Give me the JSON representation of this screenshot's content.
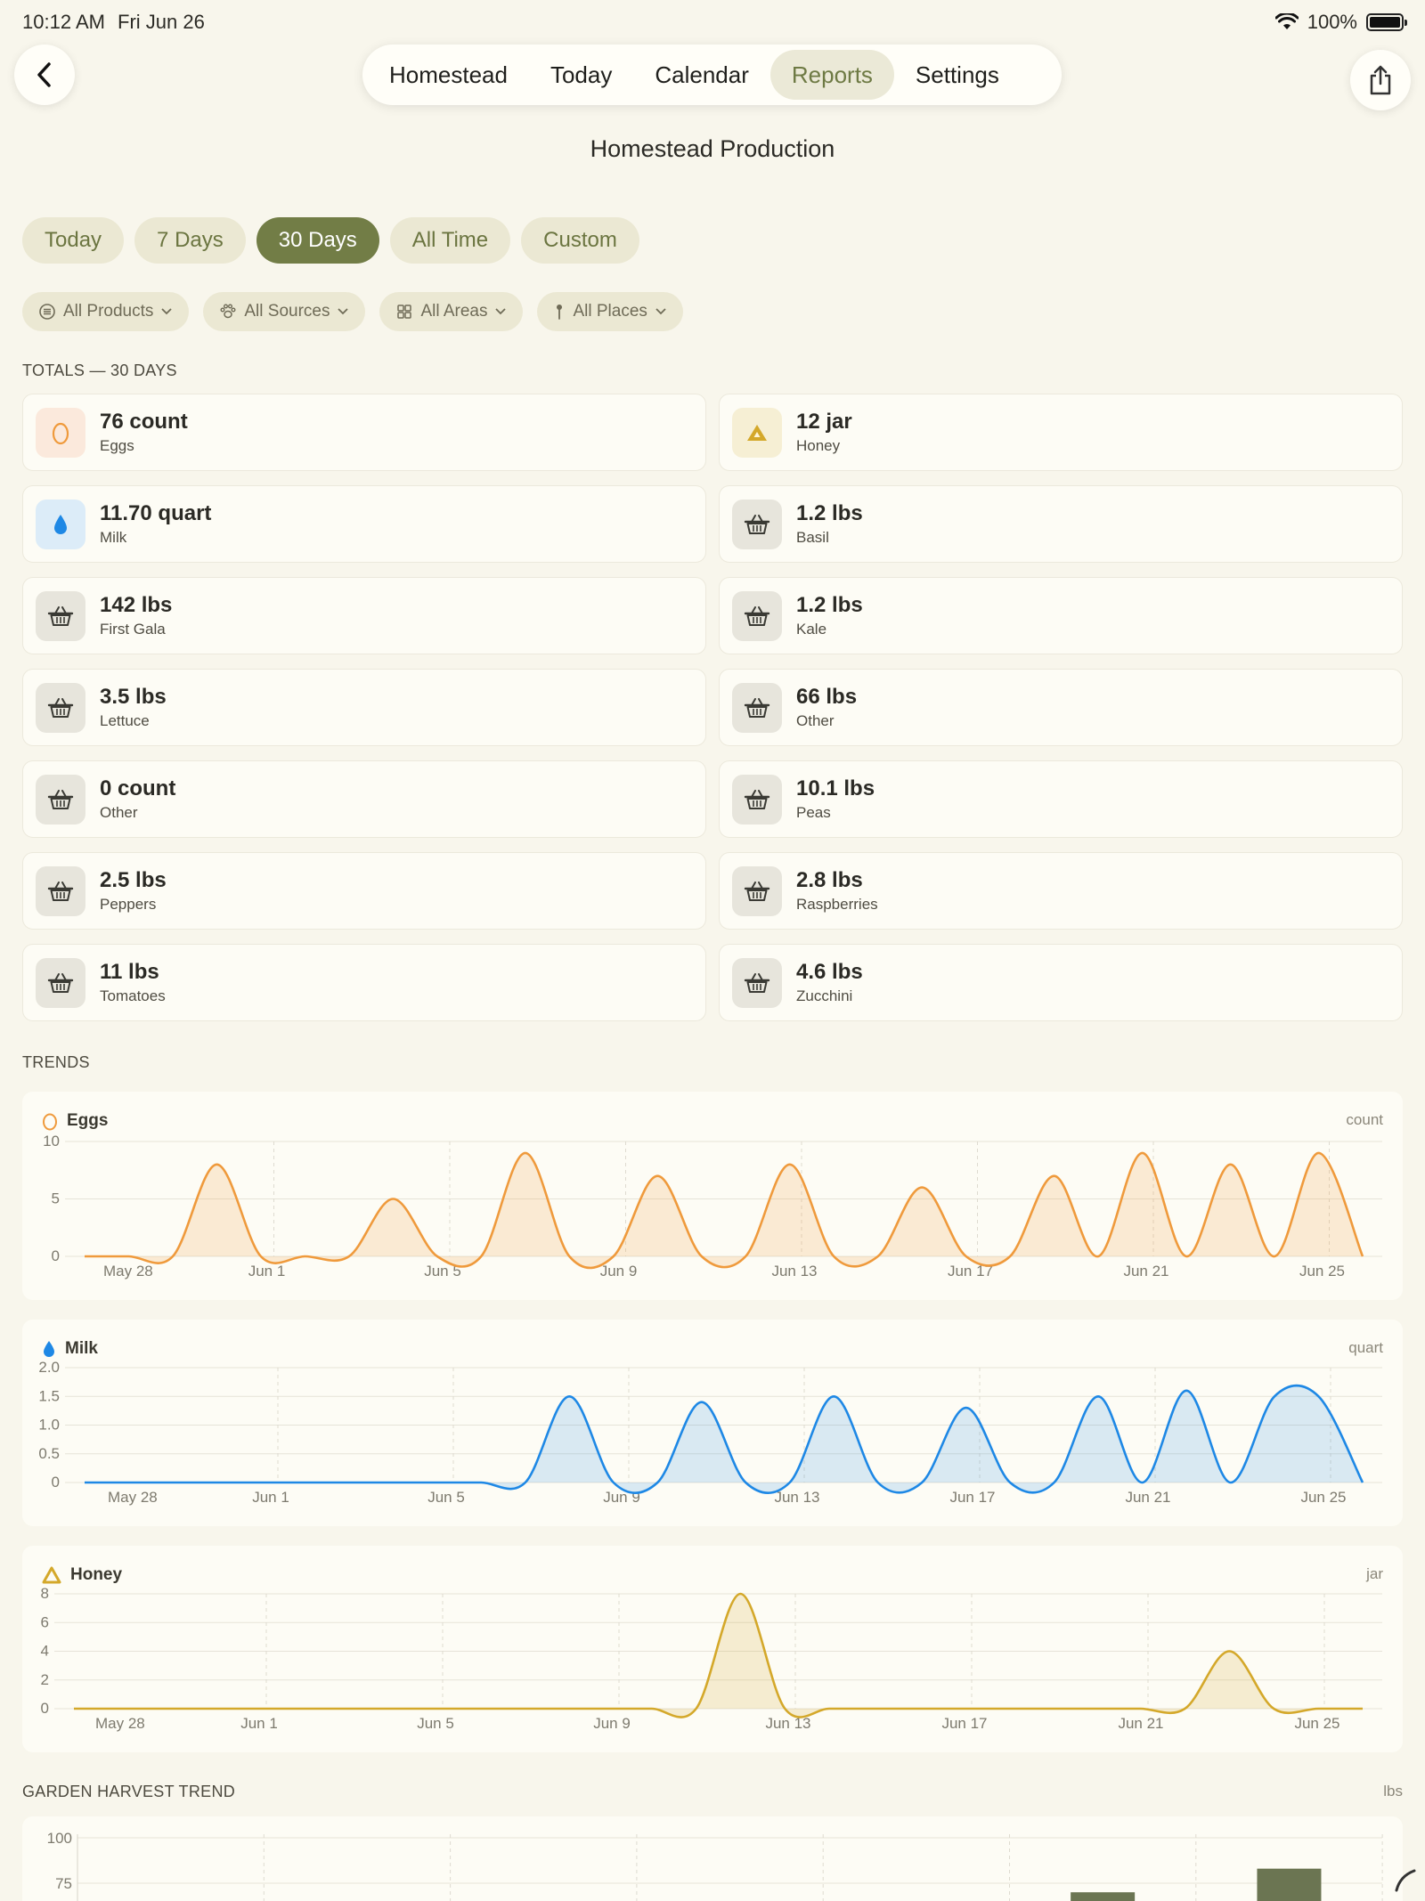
{
  "status": {
    "time": "10:12 AM",
    "date": "Fri Jun 26",
    "battery": "100%"
  },
  "nav": {
    "tabs": [
      "Homestead",
      "Today",
      "Calendar",
      "Reports",
      "Settings"
    ],
    "active": "Reports"
  },
  "page_title": "Homestead Production",
  "ranges": {
    "items": [
      "Today",
      "7 Days",
      "30 Days",
      "All Time",
      "Custom"
    ],
    "active": "30 Days"
  },
  "filters": [
    "All Products",
    "All Sources",
    "All Areas",
    "All Places"
  ],
  "totals_label": "TOTALS — 30 DAYS",
  "totals": [
    {
      "value": "76 count",
      "label": "Eggs",
      "icon": "egg-icon"
    },
    {
      "value": "12 jar",
      "label": "Honey",
      "icon": "honey-icon"
    },
    {
      "value": "11.70 quart",
      "label": "Milk",
      "icon": "milk-drop-icon"
    },
    {
      "value": "1.2 lbs",
      "label": "Basil",
      "icon": "basket-icon"
    },
    {
      "value": "142 lbs",
      "label": "First Gala",
      "icon": "basket-icon"
    },
    {
      "value": "1.2 lbs",
      "label": "Kale",
      "icon": "basket-icon"
    },
    {
      "value": "3.5 lbs",
      "label": "Lettuce",
      "icon": "basket-icon"
    },
    {
      "value": "66 lbs",
      "label": "Other",
      "icon": "basket-icon"
    },
    {
      "value": "0 count",
      "label": "Other",
      "icon": "basket-icon"
    },
    {
      "value": "10.1 lbs",
      "label": "Peas",
      "icon": "basket-icon"
    },
    {
      "value": "2.5 lbs",
      "label": "Peppers",
      "icon": "basket-icon"
    },
    {
      "value": "2.8 lbs",
      "label": "Raspberries",
      "icon": "basket-icon"
    },
    {
      "value": "11 lbs",
      "label": "Tomatoes",
      "icon": "basket-icon"
    },
    {
      "value": "4.6 lbs",
      "label": "Zucchini",
      "icon": "basket-icon"
    }
  ],
  "trends_label": "TRENDS",
  "garden_label": "GARDEN HARVEST TREND",
  "garden_unit": "lbs",
  "colors": {
    "accent": "#727d46",
    "eggs": "#ef9a3c",
    "milk": "#1e88e5",
    "honey": "#d4a82a",
    "bars": "#6b7552"
  },
  "chart_data": [
    {
      "type": "area",
      "title": "Eggs",
      "unit": "count",
      "x_ticks": [
        "May 28",
        "Jun 1",
        "Jun 5",
        "Jun 9",
        "Jun 13",
        "Jun 17",
        "Jun 21",
        "Jun 25"
      ],
      "ylim": [
        0,
        10
      ],
      "y_ticks": [
        0,
        5,
        10
      ],
      "x": [
        "May 28",
        "May 29",
        "May 30",
        "May 31",
        "Jun 1",
        "Jun 2",
        "Jun 3",
        "Jun 4",
        "Jun 5",
        "Jun 6",
        "Jun 7",
        "Jun 8",
        "Jun 9",
        "Jun 10",
        "Jun 11",
        "Jun 12",
        "Jun 13",
        "Jun 14",
        "Jun 15",
        "Jun 16",
        "Jun 17",
        "Jun 18",
        "Jun 19",
        "Jun 20",
        "Jun 21",
        "Jun 22",
        "Jun 23",
        "Jun 24",
        "Jun 25",
        "Jun 26"
      ],
      "values": [
        0,
        0,
        0,
        8,
        0,
        0,
        0,
        5,
        0,
        0,
        9,
        0,
        0,
        7,
        0,
        0,
        8,
        0,
        0,
        6,
        0,
        0,
        7,
        0,
        9,
        0,
        8,
        0,
        9,
        0
      ],
      "grid": true
    },
    {
      "type": "area",
      "title": "Milk",
      "unit": "quart",
      "x_ticks": [
        "May 28",
        "Jun 1",
        "Jun 5",
        "Jun 9",
        "Jun 13",
        "Jun 17",
        "Jun 21",
        "Jun 25"
      ],
      "ylim": [
        0,
        2.0
      ],
      "y_ticks": [
        "0",
        "0.5",
        "1.0",
        "1.5",
        "2.0"
      ],
      "x": [
        "May 28",
        "May 29",
        "May 30",
        "May 31",
        "Jun 1",
        "Jun 2",
        "Jun 3",
        "Jun 4",
        "Jun 5",
        "Jun 6",
        "Jun 7",
        "Jun 8",
        "Jun 9",
        "Jun 10",
        "Jun 11",
        "Jun 12",
        "Jun 13",
        "Jun 14",
        "Jun 15",
        "Jun 16",
        "Jun 17",
        "Jun 18",
        "Jun 19",
        "Jun 20",
        "Jun 21",
        "Jun 22",
        "Jun 23",
        "Jun 24",
        "Jun 25",
        "Jun 26"
      ],
      "values": [
        0,
        0,
        0,
        0,
        0,
        0,
        0,
        0,
        0,
        0,
        0,
        1.5,
        0,
        0,
        1.4,
        0,
        0,
        1.5,
        0,
        0,
        1.3,
        0,
        0,
        1.5,
        0,
        1.6,
        0,
        1.5,
        1.5,
        0
      ],
      "grid": true
    },
    {
      "type": "area",
      "title": "Honey",
      "unit": "jar",
      "x_ticks": [
        "May 28",
        "Jun 1",
        "Jun 5",
        "Jun 9",
        "Jun 13",
        "Jun 17",
        "Jun 21",
        "Jun 25"
      ],
      "ylim": [
        0,
        8
      ],
      "y_ticks": [
        0,
        2,
        4,
        6,
        8
      ],
      "x": [
        "May 28",
        "May 29",
        "May 30",
        "May 31",
        "Jun 1",
        "Jun 2",
        "Jun 3",
        "Jun 4",
        "Jun 5",
        "Jun 6",
        "Jun 7",
        "Jun 8",
        "Jun 9",
        "Jun 10",
        "Jun 11",
        "Jun 12",
        "Jun 13",
        "Jun 14",
        "Jun 15",
        "Jun 16",
        "Jun 17",
        "Jun 18",
        "Jun 19",
        "Jun 20",
        "Jun 21",
        "Jun 22",
        "Jun 23",
        "Jun 24",
        "Jun 25",
        "Jun 26"
      ],
      "values": [
        0,
        0,
        0,
        0,
        0,
        0,
        0,
        0,
        0,
        0,
        0,
        0,
        0,
        0,
        0,
        8,
        0,
        0,
        0,
        0,
        0,
        0,
        0,
        0,
        0,
        0,
        4,
        0,
        0,
        0
      ],
      "grid": true
    },
    {
      "type": "bar",
      "title": "GARDEN HARVEST TREND",
      "unit": "lbs",
      "y_ticks": [
        75,
        100
      ],
      "ylim": [
        0,
        100
      ],
      "bars": [
        {
          "slot": 5.5,
          "value": 70
        },
        {
          "slot": 6.5,
          "value": 83
        }
      ],
      "grid": true
    }
  ]
}
